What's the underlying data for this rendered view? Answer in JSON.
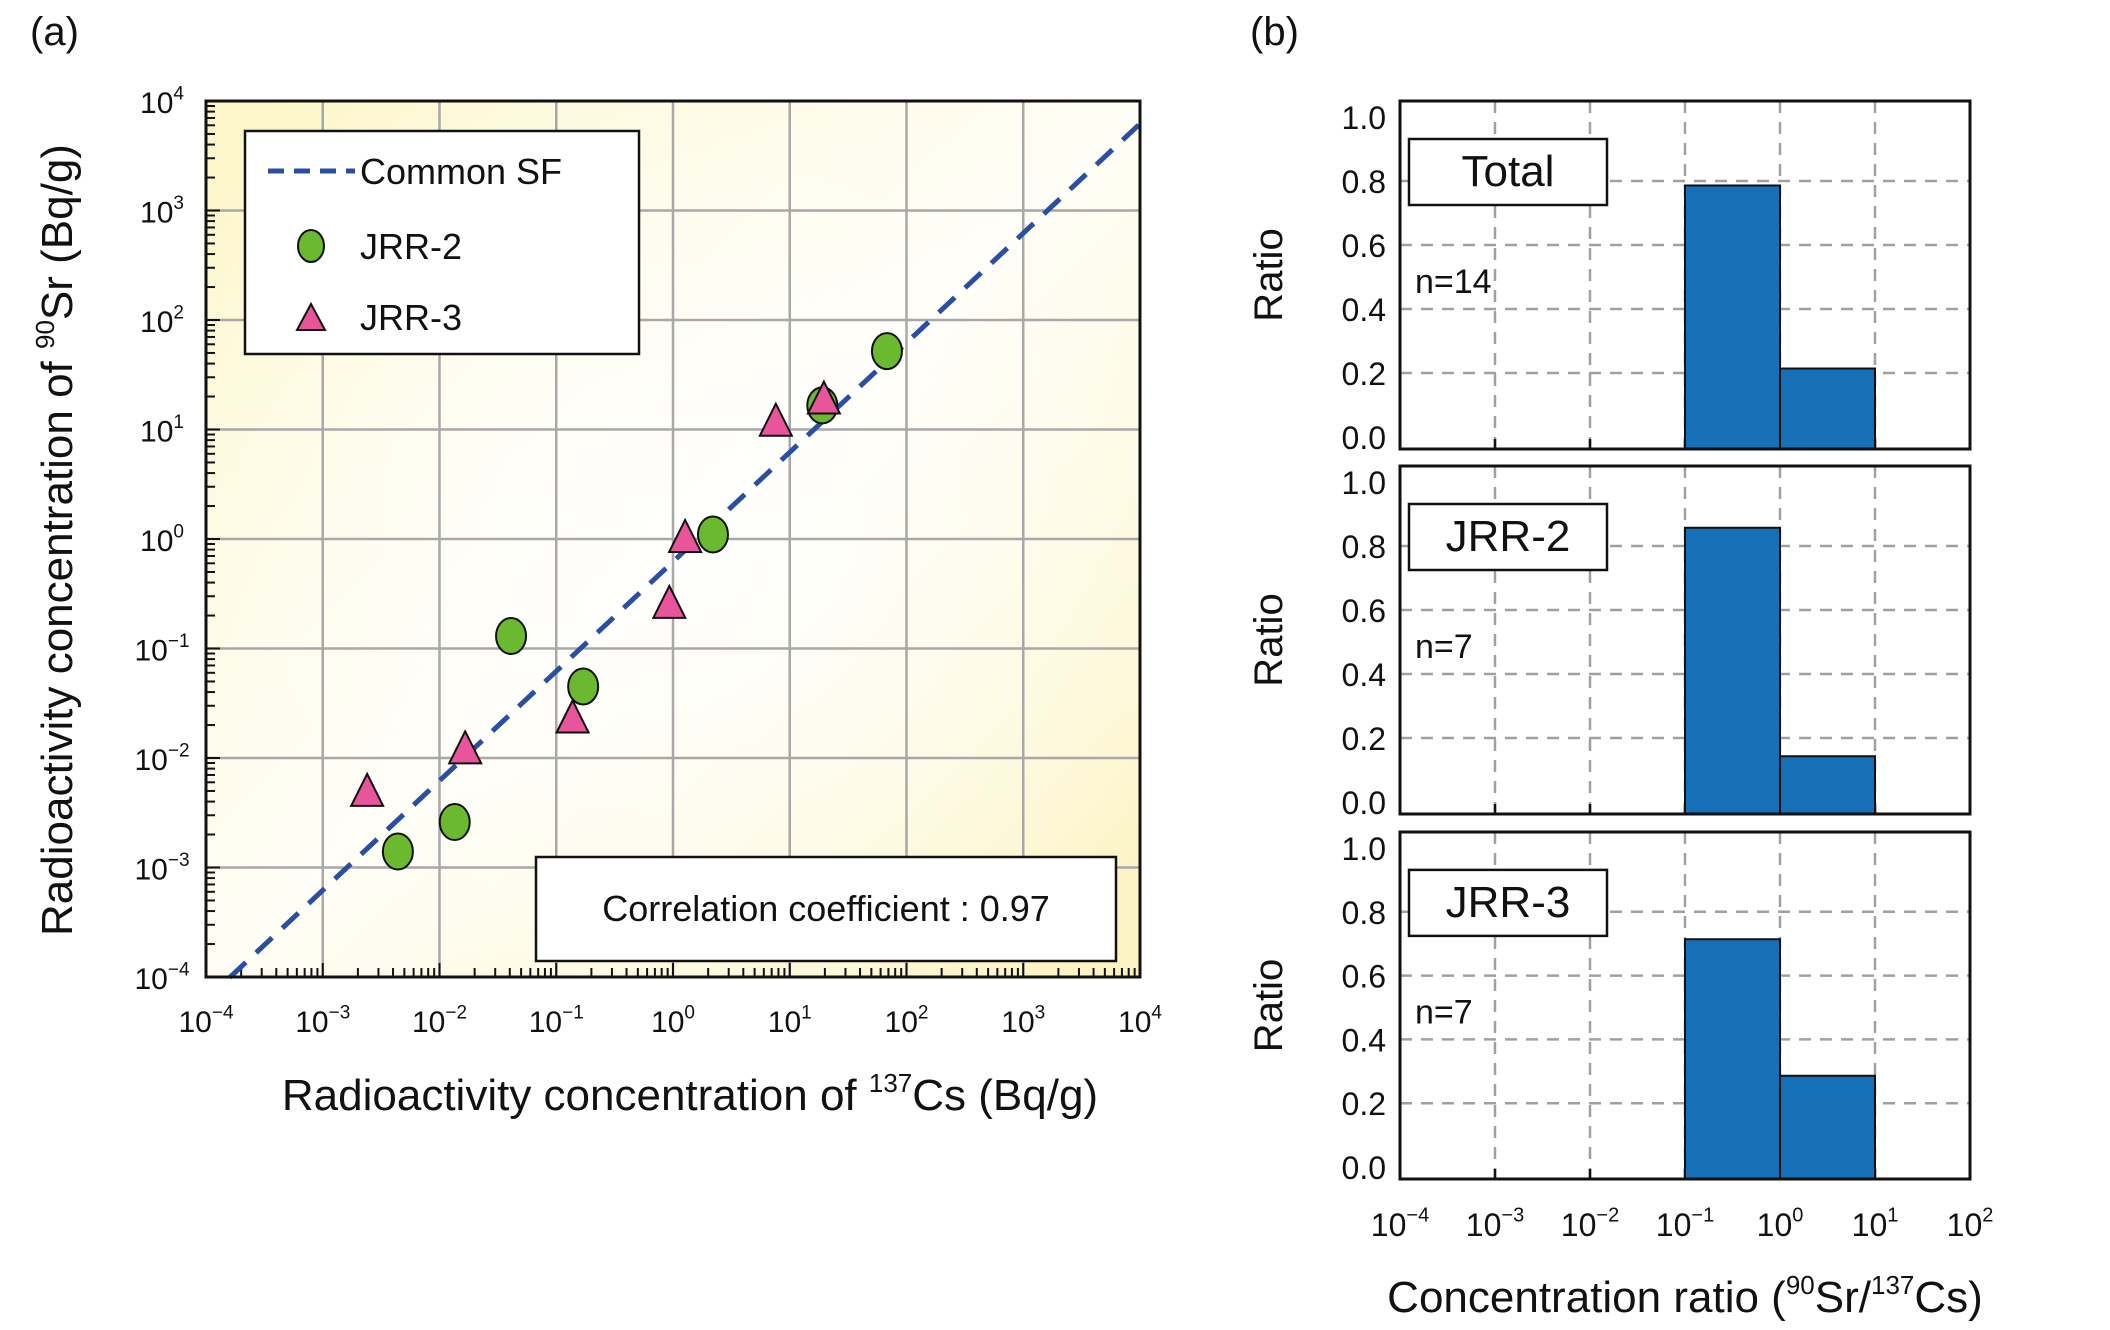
{
  "chart_data": [
    {
      "panel_label": "(a)",
      "type": "scatter",
      "xscale": "log",
      "yscale": "log",
      "xlim": [
        0.0001,
        10000
      ],
      "ylim": [
        0.0001,
        10000
      ],
      "grid": true,
      "xlabel": "Radioactivity concentration of ¹³⁷Cs (Bq/g)",
      "xlabel_prefix": "Radioactivity concentration of ",
      "xlabel_sup": "137",
      "xlabel_suffix": "Cs (Bq/g)",
      "ylabel": "Radioactivity concentration of ⁹⁰Sr (Bq/g)",
      "ylabel_prefix": "Radioactivity concentration of ",
      "ylabel_sup": "90",
      "ylabel_suffix": "Sr (Bq/g)",
      "x_ticks": [
        -4,
        -3,
        -2,
        -1,
        0,
        1,
        2,
        3,
        4
      ],
      "y_ticks": [
        -4,
        -3,
        -2,
        -1,
        0,
        1,
        2,
        3,
        4
      ],
      "legend_position": "top-left",
      "legend": [
        {
          "name": "Common SF",
          "marker": "dashed-line",
          "color": "#2a4fa0"
        },
        {
          "name": "JRR-2",
          "marker": "circle",
          "color": "#6bb92e"
        },
        {
          "name": "JRR-3",
          "marker": "triangle",
          "color": "#e8559b"
        }
      ],
      "line": {
        "name": "Common SF",
        "style": "dashed",
        "color": "#2a4fa0",
        "slope_factor": 0.62,
        "x_range": [
          0.00016,
          10000
        ]
      },
      "series": [
        {
          "name": "JRR-2",
          "marker": "circle",
          "color": "#6bb92e",
          "points": [
            [
              0.0044,
              0.0014
            ],
            [
              0.0135,
              0.0026
            ],
            [
              0.041,
              0.13
            ],
            [
              0.17,
              0.045
            ],
            [
              2.2,
              1.1
            ],
            [
              19,
              16.6
            ],
            [
              68,
              52
            ]
          ]
        },
        {
          "name": "JRR-3",
          "marker": "triangle",
          "color": "#e8559b",
          "points": [
            [
              0.0024,
              0.0047
            ],
            [
              0.0166,
              0.0115
            ],
            [
              0.138,
              0.022
            ],
            [
              0.93,
              0.245
            ],
            [
              1.27,
              0.98
            ],
            [
              7.6,
              11.3
            ],
            [
              19.6,
              18
            ]
          ]
        }
      ],
      "annotation": "Correlation coefficient : 0.97"
    },
    {
      "panel_label": "(b)",
      "type": "bar",
      "xscale": "log",
      "xlim": [
        0.0001,
        100
      ],
      "ylim": [
        0,
        1.0
      ],
      "grid": true,
      "grid_style": "dashed",
      "x_ticks": [
        -4,
        -3,
        -2,
        -1,
        0,
        1,
        2
      ],
      "y_ticks": [
        "0.0",
        "0.2",
        "0.4",
        "0.6",
        "0.8",
        "1.0"
      ],
      "ylabel": "Ratio",
      "xlabel": "Concentration ratio (⁹⁰Sr/¹³⁷Cs)",
      "xlabel_prefix": "Concentration ratio (",
      "xlabel_sup1": "90",
      "xlabel_mid": "Sr/",
      "xlabel_sup2": "137",
      "xlabel_suffix": "Cs)",
      "bar_color": "#1570b8",
      "bin_edges": [
        0.1,
        1,
        10
      ],
      "subplots": [
        {
          "title": "Total",
          "n_label": "n=14",
          "values": [
            0.786,
            0.214
          ]
        },
        {
          "title": "JRR-2",
          "n_label": "n=7",
          "values": [
            0.857,
            0.143
          ]
        },
        {
          "title": "JRR-3",
          "n_label": "n=7",
          "values": [
            0.714,
            0.286
          ]
        }
      ]
    }
  ]
}
